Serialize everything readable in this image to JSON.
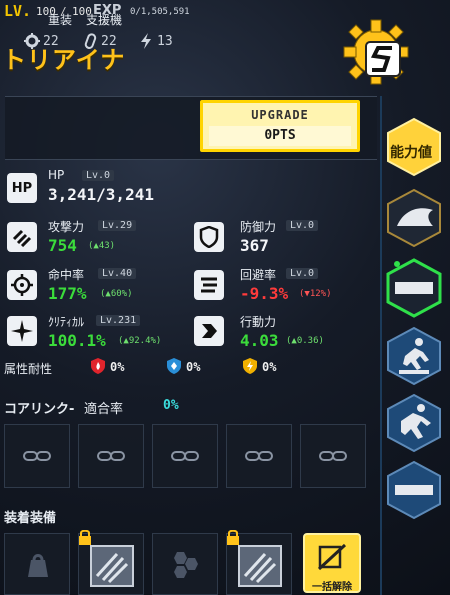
{
  "header": {
    "lv_label": "LV.",
    "level_current": "100",
    "level_sep": "/",
    "level_max": "100",
    "exp_label": "EXP",
    "exp_value": "0/1,505,591",
    "character_name": "トリアイナ"
  },
  "class_panel": {
    "class_type": "重装",
    "class_role": "支援機",
    "stats": [
      {
        "icon": "gear-icon",
        "value": "22"
      },
      {
        "icon": "capsule-icon",
        "value": "22"
      },
      {
        "icon": "lightning-icon",
        "value": "13"
      }
    ]
  },
  "upgrade": {
    "label": "UPGRADE",
    "pts": "0PTS"
  },
  "stats": {
    "hp": {
      "icon_text": "HP",
      "label": "HP",
      "lv": "Lv.0",
      "value": "3,241/3,241"
    },
    "attack": {
      "label": "攻撃力",
      "lv": "Lv.29",
      "value": "754",
      "delta": "(▲43)"
    },
    "defense": {
      "label": "防御力",
      "lv": "Lv.0",
      "value": "367"
    },
    "accuracy": {
      "label": "命中率",
      "lv": "Lv.40",
      "value": "177%",
      "delta": "(▲60%)"
    },
    "evasion": {
      "label": "回避率",
      "lv": "Lv.0",
      "value": "-9.3%",
      "delta": "(▼12%)"
    },
    "critical": {
      "label": "ｸﾘﾃｨｶﾙ",
      "lv": "Lv.231",
      "value": "100.1%",
      "delta": "(▲92.4%)"
    },
    "action": {
      "label": "行動力",
      "value": "4.03",
      "delta": "(▲0.36)"
    }
  },
  "resist": {
    "label": "属性耐性",
    "items": [
      {
        "icon": "fire-shield-icon",
        "value": "0%",
        "color": "#e0242c"
      },
      {
        "icon": "ice-shield-icon",
        "value": "0%",
        "color": "#2a8fd8"
      },
      {
        "icon": "electric-shield-icon",
        "value": "0%",
        "color": "#f0b000"
      }
    ]
  },
  "core_link": {
    "title": "コアリンク-",
    "rate_label": "適合率",
    "rate_value": "0%"
  },
  "equipment": {
    "title": "装着装備",
    "unequip_label": "一括解除"
  },
  "side_menu": {
    "status_label": "能力値"
  },
  "colors": {
    "accent": "#ffc21a",
    "green": "#3bdc3b",
    "red": "#ff3b3b",
    "menu_blue": "#1e4a78",
    "menu_green": "#2fe04a"
  }
}
